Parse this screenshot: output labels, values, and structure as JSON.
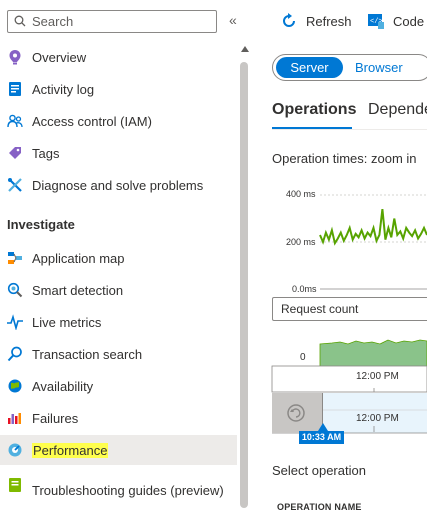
{
  "sidebar": {
    "search_placeholder": "Search",
    "collapse_glyph": "«",
    "items": [
      {
        "label": "Overview",
        "icon": "overview-icon"
      },
      {
        "label": "Activity log",
        "icon": "activity-log-icon"
      },
      {
        "label": "Access control (IAM)",
        "icon": "access-control-icon"
      },
      {
        "label": "Tags",
        "icon": "tags-icon"
      },
      {
        "label": "Diagnose and solve problems",
        "icon": "diagnose-icon"
      }
    ],
    "section_investigate": "Investigate",
    "investigate_items": [
      {
        "label": "Application map",
        "icon": "application-map-icon"
      },
      {
        "label": "Smart detection",
        "icon": "smart-detection-icon"
      },
      {
        "label": "Live metrics",
        "icon": "live-metrics-icon"
      },
      {
        "label": "Transaction search",
        "icon": "transaction-search-icon"
      },
      {
        "label": "Availability",
        "icon": "availability-icon"
      },
      {
        "label": "Failures",
        "icon": "failures-icon"
      },
      {
        "label": "Performance",
        "icon": "performance-icon",
        "selected": true,
        "highlighted": true
      },
      {
        "label": "Troubleshooting guides (preview)",
        "icon": "troubleshooting-guides-icon"
      }
    ]
  },
  "toolbar": {
    "refresh_label": "Refresh",
    "code_label": "Code"
  },
  "toggle": {
    "server_label": "Server",
    "browser_label": "Browser",
    "selected": "Server"
  },
  "tabs": [
    {
      "label": "Operations",
      "active": true
    },
    {
      "label": "Dependencies",
      "active": false
    }
  ],
  "chart": {
    "title": "Operation times: zoom in",
    "y_ticks": [
      "400 ms",
      "200 ms",
      "0.0ms"
    ]
  },
  "chart_data": {
    "type": "line",
    "title": "Operation times: zoom in",
    "ylabel": "",
    "xlabel": "",
    "y_ticks": [
      "400 ms",
      "200 ms",
      "0.0ms"
    ],
    "ylim": [
      0,
      400
    ],
    "series": [
      {
        "values": [
          230,
          200,
          240,
          210,
          250,
          195,
          215,
          240,
          205,
          230,
          260,
          210,
          235,
          220,
          250,
          215,
          240,
          225,
          260,
          205,
          230,
          340,
          210,
          260,
          220,
          300,
          230,
          245,
          215,
          260,
          240,
          225,
          250,
          215,
          235,
          260,
          230
        ]
      }
    ]
  },
  "metric_select": {
    "value": "Request count"
  },
  "timeline": {
    "zero_label": "0",
    "time_label_1": "12:00 PM",
    "time_label_2": "12:00 PM",
    "current_time": "10:33 AM"
  },
  "operations": {
    "title": "Select operation",
    "column_operation_name": "OPERATION NAME"
  },
  "colors": {
    "accent": "#0078d4",
    "line": "#57a300",
    "highlight": "#ffff4d",
    "area": "#8ac38a"
  }
}
